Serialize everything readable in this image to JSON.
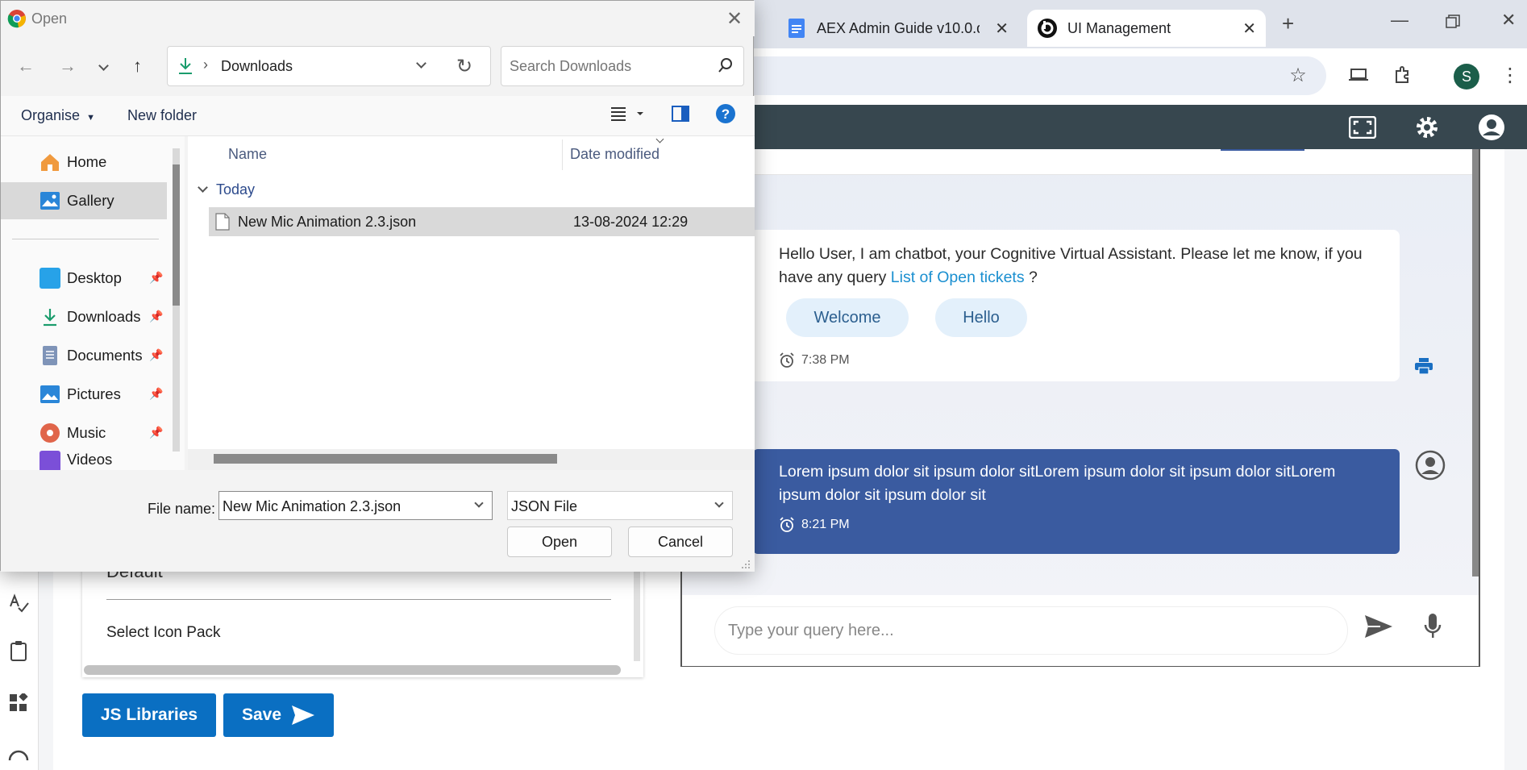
{
  "browser": {
    "tabs": [
      {
        "title": "AEX Admin Guide v10.0.d",
        "icon": "docs-icon"
      },
      {
        "title": "UI Management",
        "icon": "app-icon"
      }
    ],
    "profile_initial": "S"
  },
  "dialog": {
    "title": "Open",
    "path": "Downloads",
    "search_placeholder": "Search Downloads",
    "commands": {
      "organise": "Organise",
      "new_folder": "New folder"
    },
    "nav": [
      {
        "label": "Home"
      },
      {
        "label": "Gallery"
      },
      {
        "label": "Desktop"
      },
      {
        "label": "Downloads"
      },
      {
        "label": "Documents"
      },
      {
        "label": "Pictures"
      },
      {
        "label": "Music"
      },
      {
        "label": "Videos"
      }
    ],
    "columns": {
      "name": "Name",
      "date": "Date modified"
    },
    "group": "Today",
    "files": [
      {
        "name": "New Mic Animation 2.3.json",
        "date": "13-08-2024 12:29"
      }
    ],
    "file_name_label": "File name:",
    "file_name_value": "New Mic Animation 2.3.json",
    "file_type": "JSON File",
    "open_button": "Open",
    "cancel_button": "Cancel"
  },
  "settings": {
    "select_value": "Default",
    "icon_pack_label": "Select Icon Pack",
    "js_libraries_button": "JS Libraries",
    "save_button": "Save"
  },
  "chat": {
    "bot_message_prefix": "Hello User, I am chatbot, your Cognitive Virtual Assistant. Please let me know, if you have any query",
    "bot_message_link": "List of Open tickets",
    "bot_message_suffix": " ?",
    "chips": [
      "Welcome",
      "Hello"
    ],
    "bot_time": "7:38 PM",
    "user_message": "Lorem ipsum dolor sit ipsum dolor sitLorem ipsum dolor sit ipsum dolor sitLorem ipsum dolor sit ipsum dolor sit",
    "user_time": "8:21 PM",
    "input_placeholder": "Type your query here..."
  },
  "colors": {
    "appbar": "#37474f",
    "user_bubble": "#3a5ba0",
    "primary_button": "#0a6fc2",
    "link": "#1a8fd0"
  }
}
